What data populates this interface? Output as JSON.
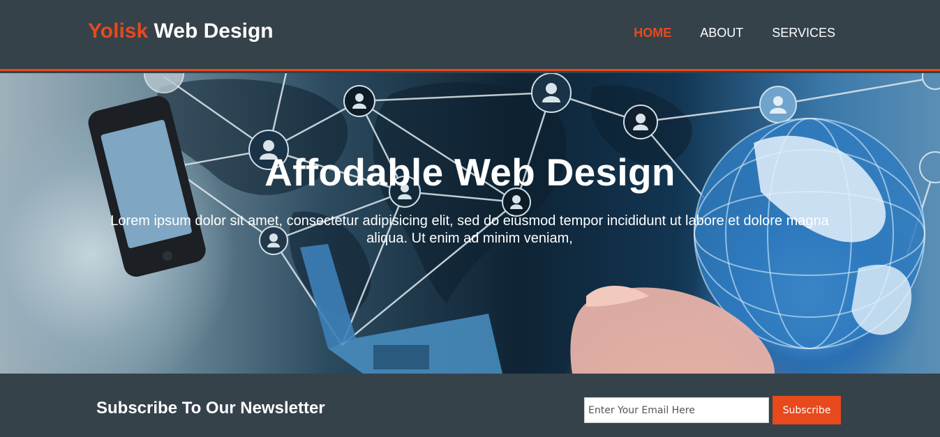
{
  "header": {
    "brand_accent": "Yolisk",
    "brand_rest": " Web Design",
    "nav": [
      {
        "label": "HOME",
        "active": true
      },
      {
        "label": "ABOUT",
        "active": false
      },
      {
        "label": "SERVICES",
        "active": false
      }
    ]
  },
  "showcase": {
    "title": "Affodable Web Design",
    "text": "Lorem ipsum dolor sit amet, consectetur adipisicing elit, sed do eiusmod tempor incididunt ut labore et dolore magna aliqua. Ut enim ad minim veniam,"
  },
  "newsletter": {
    "heading": "Subscribe To Our Newsletter",
    "email_placeholder": "Enter Your Email Here",
    "email_value": "",
    "button_label": "Subscribe"
  },
  "colors": {
    "accent": "#e8491d",
    "dark": "#35424a",
    "white": "#ffffff"
  }
}
